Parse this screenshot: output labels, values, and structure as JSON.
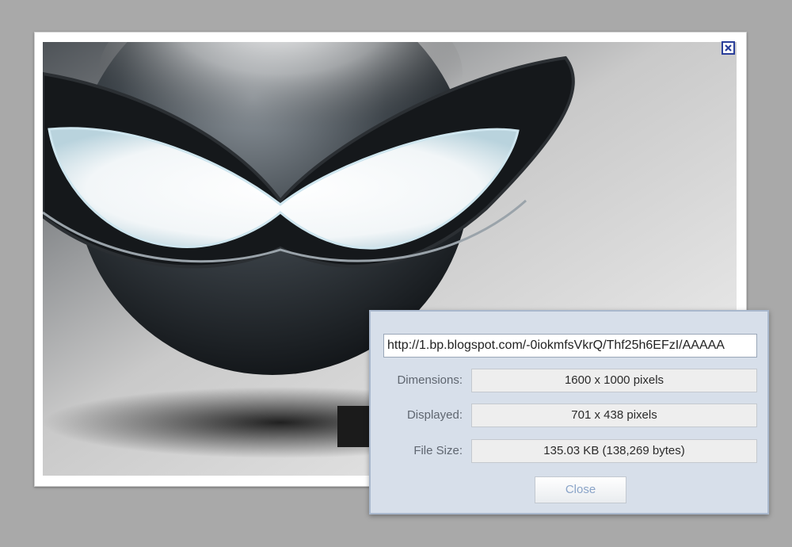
{
  "colors": {
    "backdrop": "#a9a9a9",
    "panel_background": "#d7dfea",
    "close_icon": "#2b3f9a",
    "close_button_text": "#8aa4c8"
  },
  "viewer": {
    "image_alt": "Dark glowing-eyed mask sphere",
    "caption_icon": "close-x-icon"
  },
  "info": {
    "url": "http://1.bp.blogspot.com/-0iokmfsVkrQ/Thf25h6EFzI/AAAAA",
    "dimensions_label": "Dimensions:",
    "dimensions_value": "1600 x 1000 pixels",
    "displayed_label": "Displayed:",
    "displayed_value": "701 x 438 pixels",
    "filesize_label": "File Size:",
    "filesize_value": "135.03 KB (138,269 bytes)",
    "close_label": "Close"
  }
}
